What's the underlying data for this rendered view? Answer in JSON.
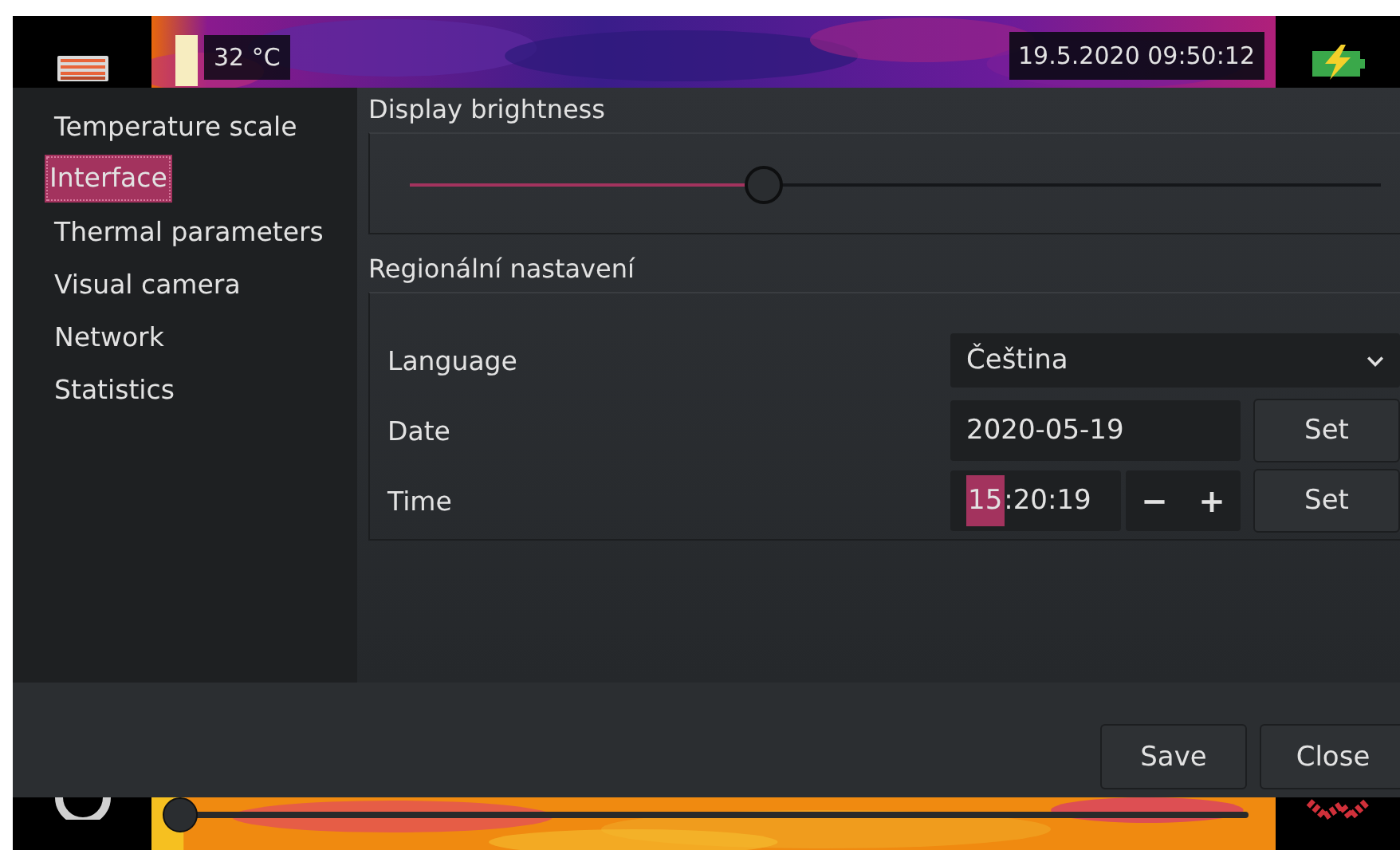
{
  "status": {
    "temperature": "32 °C",
    "datetime": "19.5.2020 09:50:12"
  },
  "sidebar": {
    "items": [
      {
        "label": "Temperature scale",
        "selected": false
      },
      {
        "label": "Interface",
        "selected": true
      },
      {
        "label": "Thermal parameters",
        "selected": false
      },
      {
        "label": "Visual camera",
        "selected": false
      },
      {
        "label": "Network",
        "selected": false
      },
      {
        "label": "Statistics",
        "selected": false
      }
    ]
  },
  "display": {
    "title": "Display brightness",
    "brightness": {
      "level": 0.365
    }
  },
  "regional": {
    "title": "Regionální nastavení",
    "rows": [
      {
        "kind": "select",
        "label": "Language",
        "value": "Čeština"
      },
      {
        "kind": "date",
        "label": "Date",
        "value": "2020-05-19",
        "button": "Set"
      },
      {
        "kind": "time",
        "label": "Time",
        "hours": "15",
        "hours_selected": true,
        "rest": ":20:19",
        "minus": "−",
        "plus": "+",
        "button": "Set"
      }
    ]
  },
  "buttons": [
    "Save",
    "Close"
  ],
  "palette_slider": {
    "level": 0.015
  }
}
